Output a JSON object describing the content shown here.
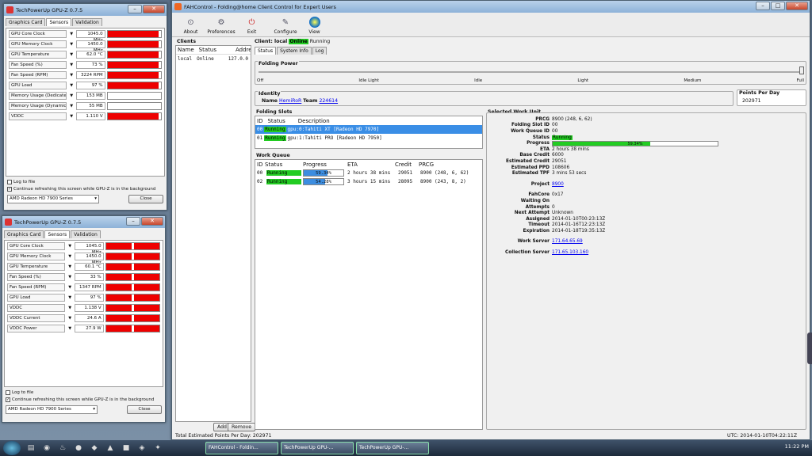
{
  "gpuz1": {
    "title": "TechPowerUp GPU-Z 0.7.5",
    "tabs": [
      "Graphics Card",
      "Sensors",
      "Validation"
    ],
    "sensors": [
      {
        "label": "GPU Core Clock",
        "value": "1045.0 MHz",
        "level": 0.95
      },
      {
        "label": "GPU Memory Clock",
        "value": "1450.0 MHz",
        "level": 0.95
      },
      {
        "label": "GPU Temperature",
        "value": "62.0 °C",
        "level": 0.95
      },
      {
        "label": "Fan Speed (%)",
        "value": "73 %",
        "level": 0.95
      },
      {
        "label": "Fan Speed (RPM)",
        "value": "3224 RPM",
        "level": 0.95
      },
      {
        "label": "GPU Load",
        "value": "97 %",
        "level": 0.95
      },
      {
        "label": "Memory Usage (Dedicated)",
        "value": "153 MB",
        "level": 0
      },
      {
        "label": "Memory Usage (Dynamic)",
        "value": "55 MB",
        "level": 0
      },
      {
        "label": "VDDC",
        "value": "1.110 V",
        "level": 0.95
      }
    ],
    "log": "Log to file",
    "cont": "Continue refreshing this screen while GPU-Z is in the background",
    "gpu": "AMD Radeon HD 7900 Series",
    "close": "Close"
  },
  "gpuz2": {
    "title": "TechPowerUp GPU-Z 0.7.5",
    "tabs": [
      "Graphics Card",
      "Sensors",
      "Validation"
    ],
    "sensors": [
      {
        "label": "GPU Core Clock",
        "value": "1045.0 MHz"
      },
      {
        "label": "GPU Memory Clock",
        "value": "1450.0 MHz"
      },
      {
        "label": "GPU Temperature",
        "value": "60.1 °C"
      },
      {
        "label": "Fan Speed (%)",
        "value": "33 %"
      },
      {
        "label": "Fan Speed (RPM)",
        "value": "1347 RPM"
      },
      {
        "label": "GPU Load",
        "value": "97 %"
      },
      {
        "label": "VDDC",
        "value": "1.138 V"
      },
      {
        "label": "VDDC Current",
        "value": "24.6 A"
      },
      {
        "label": "VDDC Power",
        "value": "27.9 W"
      }
    ],
    "log": "Log to file",
    "cont": "Continue refreshing this screen while GPU-Z is in the background",
    "gpu": "AMD Radeon HD 7900 Series",
    "close": "Close"
  },
  "fah": {
    "title": "FAHControl - Folding@home Client Control for Expert Users",
    "toolbar": {
      "about": "About",
      "prefs": "Preferences",
      "exit": "Exit",
      "configure": "Configure",
      "view": "View"
    },
    "clients": {
      "title": "Clients",
      "cols": [
        "Name",
        "Status",
        "Address"
      ],
      "row": [
        "local",
        "Online",
        "127.0.0"
      ],
      "add": "Add",
      "remove": "Remove"
    },
    "client_header": {
      "prefix": "Client: local",
      "online": "Online",
      "state": "Running"
    },
    "tabs": [
      "Status",
      "System Info",
      "Log"
    ],
    "power": {
      "title": "Folding Power",
      "labels": [
        "Off",
        "Idle Light",
        "Idle",
        "Light",
        "Medium",
        "Full"
      ]
    },
    "identity": {
      "title": "Identity",
      "name_label": "Name",
      "name": "HemiRoR",
      "team_label": "Team",
      "team": "224614"
    },
    "ppd": {
      "title": "Points Per Day",
      "value": "202971"
    },
    "slots": {
      "title": "Folding Slots",
      "cols": [
        "ID",
        "Status",
        "Description"
      ],
      "rows": [
        {
          "id": "00",
          "status": "Running",
          "desc": "gpu:0:Tahiti XT [Radeon HD 7970]"
        },
        {
          "id": "01",
          "status": "Running",
          "desc": "gpu:1:Tahiti PRO [Radeon HD 7950]"
        }
      ]
    },
    "queue": {
      "title": "Work Queue",
      "cols": [
        "ID",
        "Status",
        "Progress",
        "ETA",
        "Credit",
        "PRCG"
      ],
      "rows": [
        {
          "id": "00",
          "status": "Running",
          "progress": "59.34%",
          "pct": 59.34,
          "eta": "2 hours 38 mins",
          "credit": "29051",
          "prcg": "8900 (248, 6, 62)"
        },
        {
          "id": "02",
          "status": "Running",
          "progress": "54.28%",
          "pct": 54.28,
          "eta": "3 hours 15 mins",
          "credit": "28095",
          "prcg": "8900 (243, 8, 2)"
        }
      ]
    },
    "swu": {
      "title": "Selected Work Unit",
      "prcg": "8900 (248, 6, 62)",
      "slot": "00",
      "queue": "00",
      "status": "Running",
      "progress": "59.34%",
      "pct": 59.34,
      "eta": "2 hours 38 mins",
      "base": "6000",
      "est_credit": "29051",
      "est_ppd": "108606",
      "est_tpf": "3 mins 53 secs",
      "project": "8900",
      "fahcore": "0x17",
      "waiting": "",
      "attempts": "0",
      "next": "Unknown",
      "assigned": "2014-01-10T00:23:13Z",
      "timeout": "2014-01-16T12:23:13Z",
      "expiration": "2014-01-18T19:35:13Z",
      "work_server": "171.64.65.69",
      "coll_server": "171.65.103.160",
      "labels": {
        "prcg": "PRCG",
        "slot": "Folding Slot ID",
        "queue": "Work Queue ID",
        "status": "Status",
        "progress": "Progress",
        "eta": "ETA",
        "base": "Base Credit",
        "est_credit": "Estimated Credit",
        "est_ppd": "Estimated PPD",
        "est_tpf": "Estimated TPF",
        "project": "Project",
        "fahcore": "FahCore",
        "waiting": "Waiting On",
        "attempts": "Attempts",
        "next": "Next Attempt",
        "assigned": "Assigned",
        "timeout": "Timeout",
        "expiration": "Expiration",
        "work_server": "Work Server",
        "coll_server": "Collection Server"
      }
    },
    "footer": {
      "total": "Total Estimated Points Per Day: 202971",
      "utc": "UTC: 2014-01-10T04:22:11Z"
    }
  },
  "taskbar": {
    "tasks": [
      "FAHControl - Foldin...",
      "TechPowerUp GPU-...",
      "TechPowerUp GPU-..."
    ],
    "time": "11:22 PM"
  },
  "colors": {
    "running": "#22cc22",
    "progress": "#3c8de0",
    "graph": "#ee0000"
  }
}
